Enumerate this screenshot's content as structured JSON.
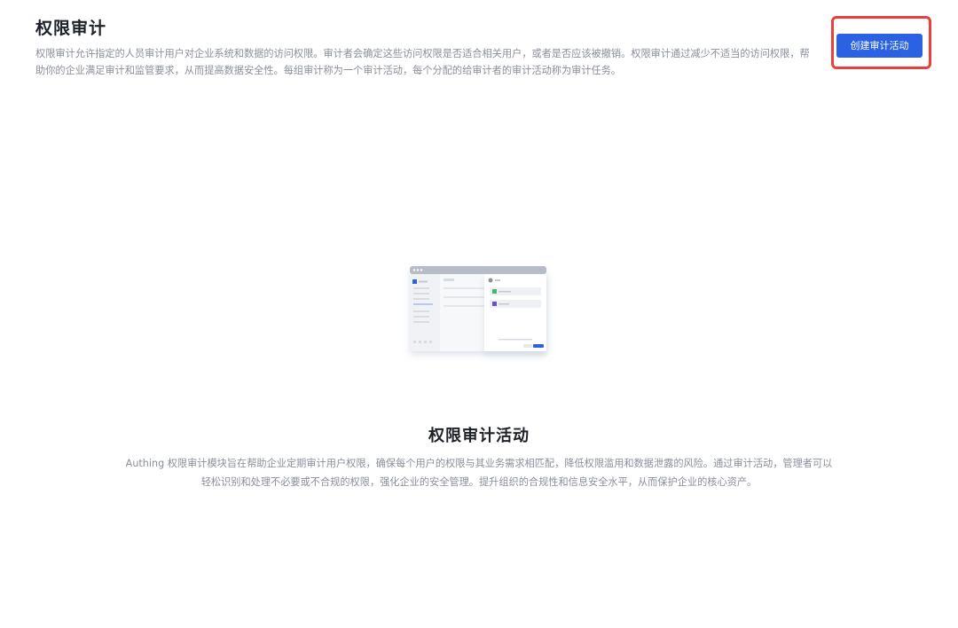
{
  "header": {
    "title": "权限审计",
    "description": "权限审计允许指定的人员审计用户对企业系统和数据的访问权限。审计者会确定这些访问权限是否适合相关用户，或者是否应该被撤销。权限审计通过减少不适当的访问权限，帮助你的企业满足审计和监管要求，从而提高数据安全性。每组审计称为一个审计活动，每个分配的给审计者的审计活动称为审计任务。"
  },
  "actions": {
    "create_label": "创建审计活动"
  },
  "empty_state": {
    "title": "权限审计活动",
    "description": "Authing 权限审计模块旨在帮助企业定期审计用户权限，确保每个用户的权限与其业务需求相匹配，降低权限滥用和数据泄露的风险。通过审计活动，管理者可以轻松识别和处理不必要或不合规的权限，强化企业的安全管理。提升组织的合规性和信息安全水平，从而保护企业的核心资产。"
  },
  "colors": {
    "primary": "#2b62e3",
    "highlight": "#e8403a",
    "muted_text": "#8a8f99",
    "title_text": "#1d2129"
  }
}
